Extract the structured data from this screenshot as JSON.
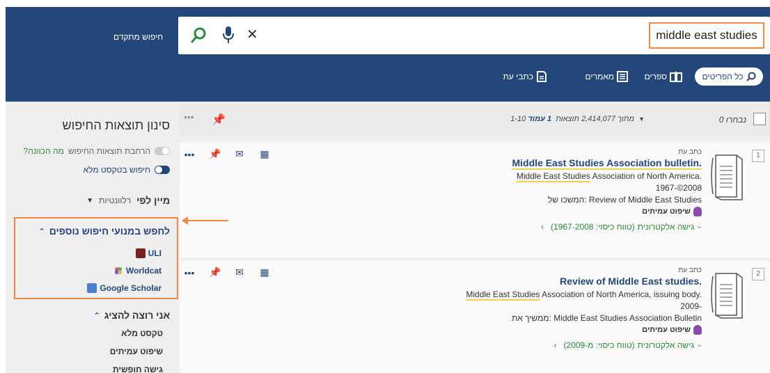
{
  "header": {
    "advanced_search": "חיפוש מתקדם",
    "search_value": "middle east studies",
    "scope_all": "כל הפריטים",
    "tabs": [
      {
        "label": "ספרים"
      },
      {
        "label": "מאמרים"
      },
      {
        "label": "כתבי עת"
      }
    ]
  },
  "results_header": {
    "selected": "0 נבחרו",
    "page_label": "עמוד",
    "page_number": "1",
    "range": "1-10 מתוך 2,414,077 תוצאות"
  },
  "results": [
    {
      "number": "1",
      "type": "כתב עת",
      "title": "Middle East Studies Association bulletin.",
      "author_hl": "Middle East Studies",
      "author_rest": " Association of North America.",
      "date": "1967-©2008",
      "related": "המשכו של: Review of Middle East Studies",
      "peer_review": "שיפוט עמיתים",
      "access": "גישה אלקטרונית",
      "coverage": "(טווח כיסוי: 1967-2008)"
    },
    {
      "number": "2",
      "type": "כתב עת",
      "title": "Review of Middle East studies.",
      "author_hl": "Middle East Studies",
      "author_rest": " Association of North America, issuing body.",
      "date": "2009-",
      "related": "ממשיך את: Middle East Studies Association Bulletin",
      "peer_review": "שיפוט עמיתים",
      "access": "גישה אלקטרונית",
      "coverage": "(טווח כיסוי: מ-2009)"
    }
  ],
  "sidebar": {
    "filter_title": "סינון תוצאות החיפוש",
    "expand_label": "הרחבת תוצאות החיפוש",
    "expand_what": "מה הכוונה?",
    "fulltext_label": "חיפוש בטקסט מלא",
    "sort_label": "מיין לפי",
    "sort_value": "רלוונטיות",
    "external_heading": "לחפש במנועי חיפוש נוספים",
    "external_links": [
      "ULI",
      "Worldcat",
      "Google Scholar"
    ],
    "show_heading": "אני רוצה להציג",
    "show_items": [
      "טקסט מלא",
      "שיפוט עמיתים",
      "גישה חופשית"
    ]
  },
  "colors": {
    "header_bg": "#23477a",
    "highlight_border": "#f08742",
    "access_green": "#2a8a3a"
  }
}
